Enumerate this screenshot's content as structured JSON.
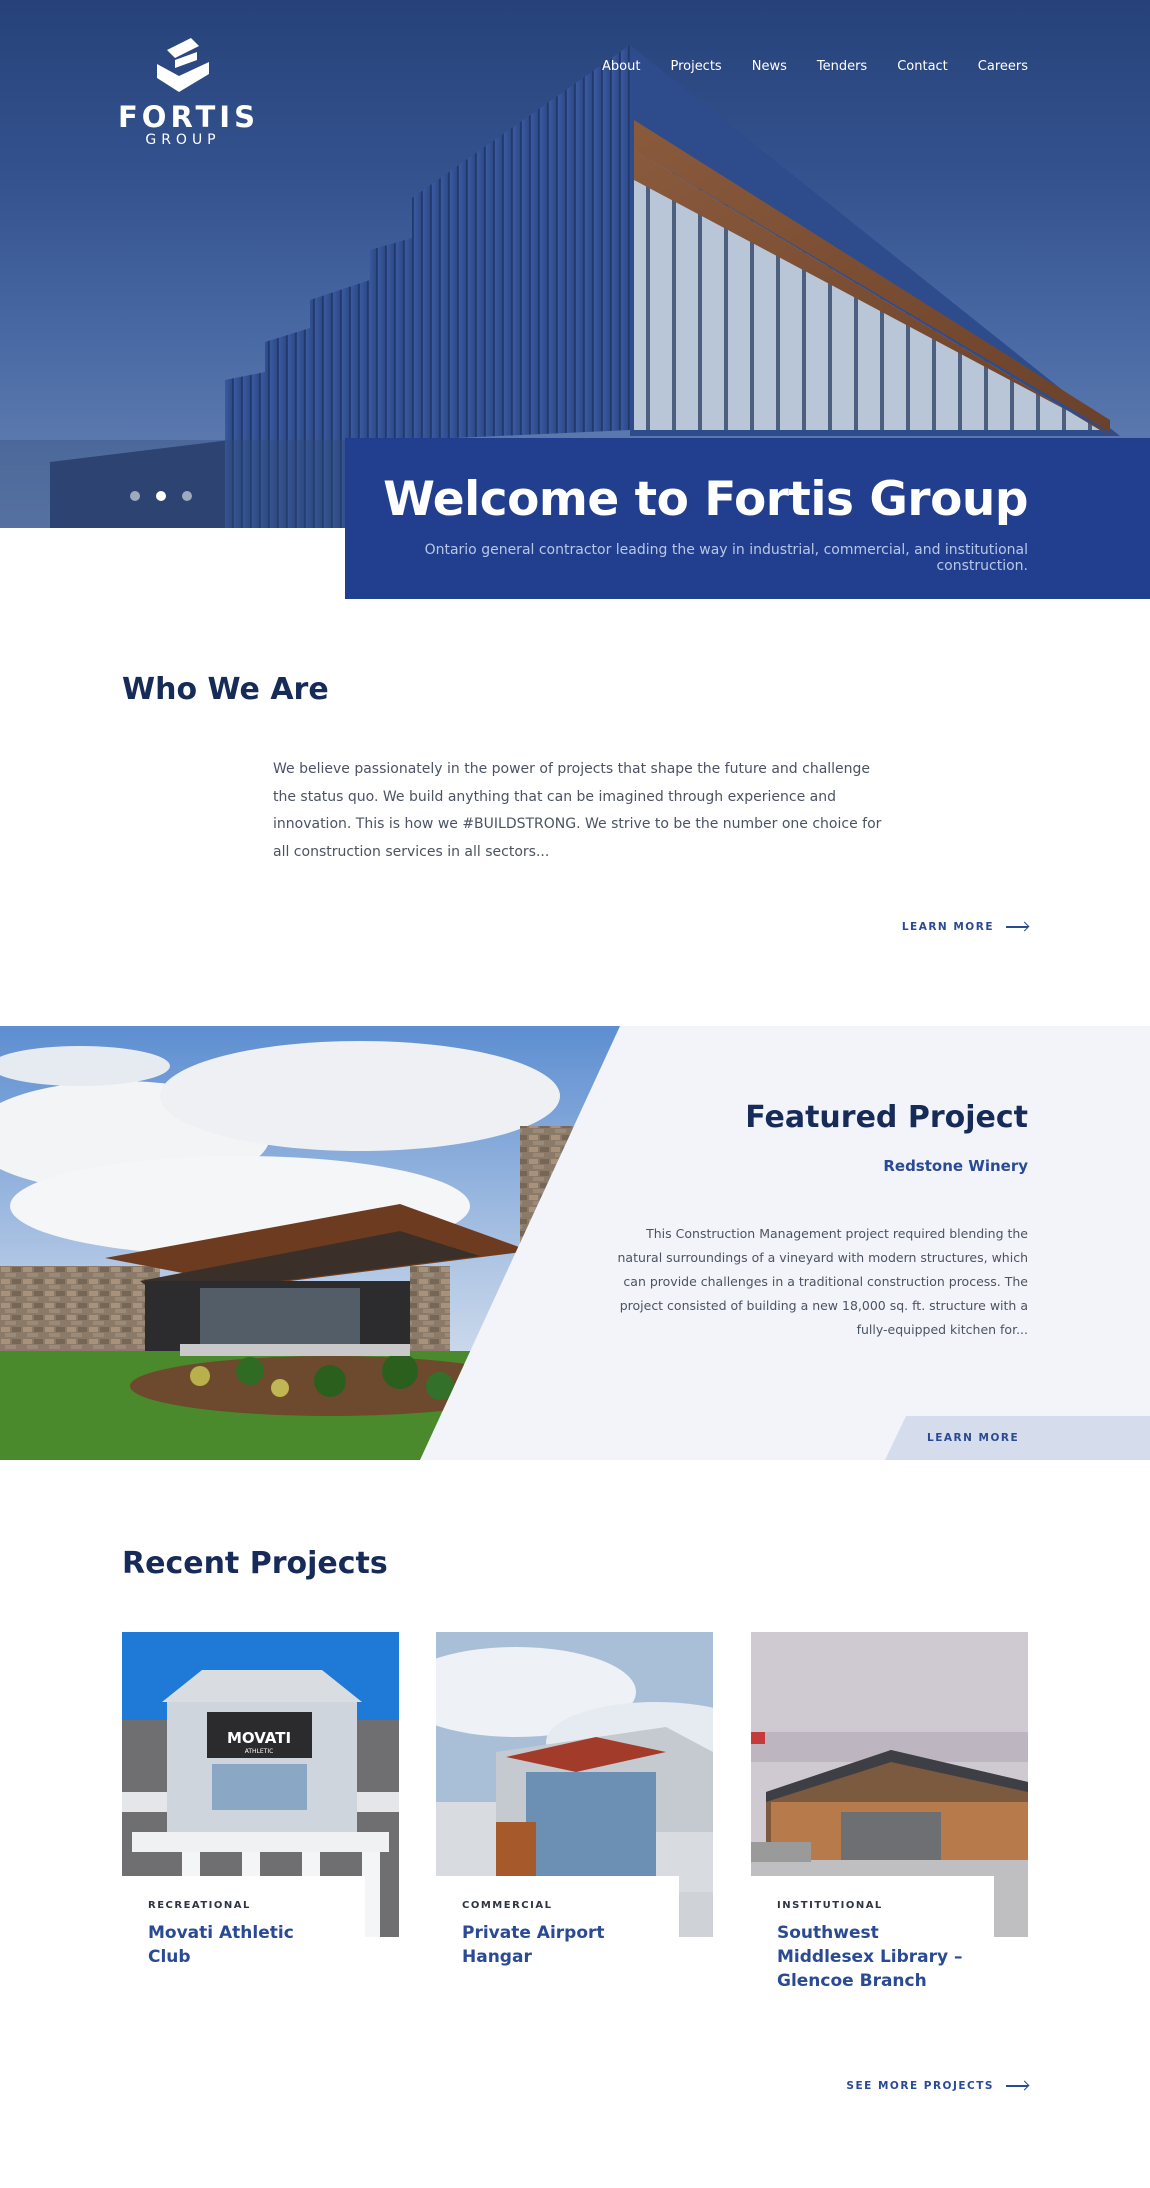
{
  "brand": {
    "name": "FORTIS",
    "sub": "GROUP"
  },
  "nav": [
    "About",
    "Projects",
    "News",
    "Tenders",
    "Contact",
    "Careers"
  ],
  "hero": {
    "title": "Welcome to Fortis Group",
    "subtitle": "Ontario general contractor leading the way in industrial, commercial, and institutional construction.",
    "slides": 3,
    "active_slide": 2
  },
  "who": {
    "title": "Who We Are",
    "text": "We believe passionately in the power of projects that shape the future and challenge the status quo. We build anything that can be imagined through experience and innovation. This is how we #BUILDSTRONG. We strive to be the number one choice for all construction services in all sectors...",
    "link": "LEARN MORE"
  },
  "featured": {
    "title": "Featured Project",
    "project": "Redstone Winery",
    "text": "This Construction Management project required blending the natural surroundings of a vineyard with modern structures, which can provide challenges in a traditional construction process. The project consisted of building a new 18,000 sq. ft. structure with a fully-equipped kitchen for...",
    "link": "LEARN MORE"
  },
  "recent": {
    "title": "Recent Projects",
    "projects": [
      {
        "category": "RECREATIONAL",
        "name": "Movati Athletic Club",
        "sign": "MOVATI",
        "sign_sub": "ATHLETIC"
      },
      {
        "category": "COMMERCIAL",
        "name": "Private Airport Hangar"
      },
      {
        "category": "INSTITUTIONAL",
        "name": "Southwest Middlesex Library – Glencoe Branch"
      }
    ],
    "link": "SEE MORE PROJECTS"
  },
  "colors": {
    "navy": "#172b59",
    "accent": "#223f8f",
    "link": "#2a4a94",
    "panel": "#f2f4f9"
  }
}
